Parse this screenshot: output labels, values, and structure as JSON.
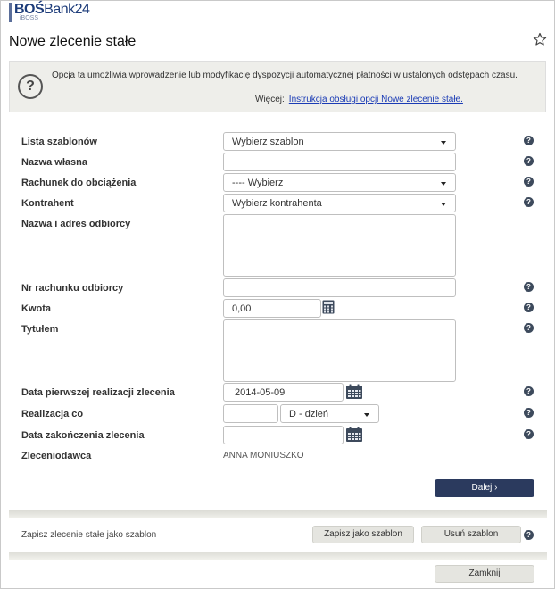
{
  "brand": {
    "name_bold": "BOŚ",
    "name_rest": "Bank24",
    "sub": "iBOSS"
  },
  "page_title": "Nowe zlecenie stałe",
  "info": {
    "icon": "question-circle-icon",
    "text": "Opcja ta umożliwia wprowadzenie lub modyfikację dyspozycji automatycznej płatności w ustalonych odstępach czasu.",
    "more_label": "Więcej:",
    "more_link": "Instrukcja obsługi opcji Nowe zlecenie stałe."
  },
  "form": {
    "templates": {
      "label": "Lista szablonów",
      "value": "Wybierz szablon"
    },
    "own_name": {
      "label": "Nazwa własna",
      "value": ""
    },
    "debit_account": {
      "label": "Rachunek do obciążenia",
      "value": "---- Wybierz"
    },
    "contractor": {
      "label": "Kontrahent",
      "value": "Wybierz kontrahenta"
    },
    "recipient_name": {
      "label": "Nazwa i adres odbiorcy",
      "value": ""
    },
    "recipient_account": {
      "label": "Nr rachunku odbiorcy",
      "value": ""
    },
    "amount": {
      "label": "Kwota",
      "value": "0,00"
    },
    "title": {
      "label": "Tytułem",
      "value": ""
    },
    "first_date": {
      "label": "Data pierwszej realizacji zlecenia",
      "value": "2014-05-09"
    },
    "frequency": {
      "label": "Realizacja co",
      "value": "",
      "unit": "D - dzień"
    },
    "end_date": {
      "label": "Data zakończenia zlecenia",
      "value": ""
    },
    "ordering_party": {
      "label": "Zleceniodawca",
      "value": "ANNA MONIUSZKO"
    }
  },
  "buttons": {
    "next": "Dalej",
    "save_template": "Zapisz jako szablon",
    "delete_template": "Usuń szablon",
    "close": "Zamknij"
  },
  "template_section": {
    "label": "Zapisz zlecenie stałe jako szablon"
  },
  "help_glyph": "?",
  "colors": {
    "primary_button": "#2b3a5e",
    "link": "#1a3bb5",
    "panel": "#eeeeea",
    "brand": "#1d3c7a"
  }
}
